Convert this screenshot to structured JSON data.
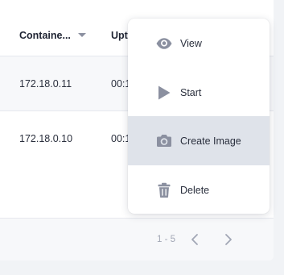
{
  "table": {
    "columns": [
      "Containe...",
      "Upt"
    ],
    "rows": [
      {
        "ip": "172.18.0.11",
        "uptime": "00:1"
      },
      {
        "ip": "172.18.0.10",
        "uptime": "00:1"
      }
    ]
  },
  "pagination": {
    "range": "1 - 5"
  },
  "context_menu": {
    "items": [
      {
        "label": "View",
        "icon": "eye-icon",
        "active": false
      },
      {
        "label": "Start",
        "icon": "play-icon",
        "active": false
      },
      {
        "label": "Create Image",
        "icon": "camera-icon",
        "active": true
      },
      {
        "label": "Delete",
        "icon": "trash-icon",
        "active": false
      }
    ]
  },
  "colors": {
    "icon": "#8b90a0",
    "active_item_bg": "#dfe3ea",
    "text": "#2a2f3d",
    "background": "#f1f3f6"
  }
}
